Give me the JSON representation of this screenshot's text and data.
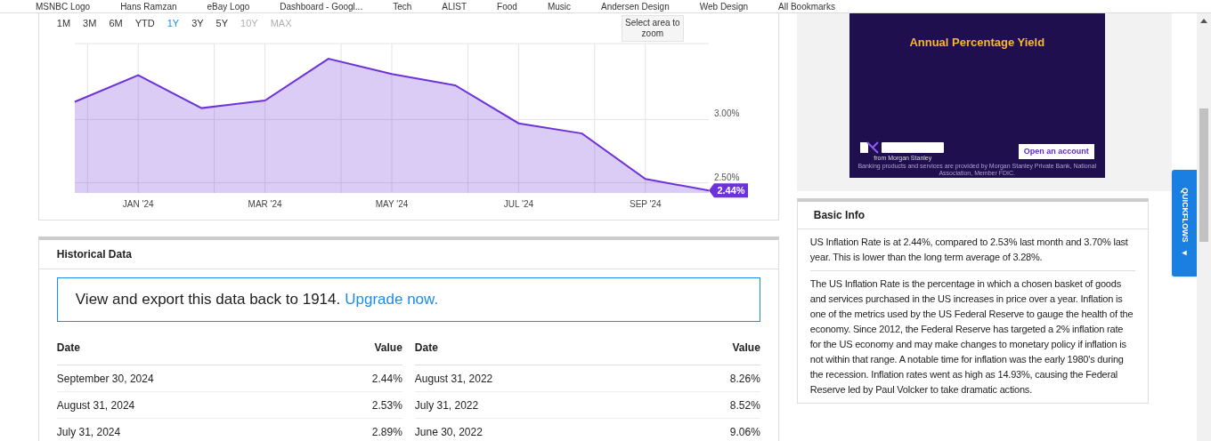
{
  "bookmarks": [
    "MSNBC Logo",
    "Hans Ramzan",
    "eBay Logo",
    "Dashboard - Googl...",
    "Tech",
    "ALIST",
    "Food",
    "Music",
    "Andersen Design",
    "Web Design",
    "All Bookmarks"
  ],
  "chart": {
    "ranges": [
      {
        "label": "1M",
        "selected": false,
        "disabled": false
      },
      {
        "label": "3M",
        "selected": false,
        "disabled": false
      },
      {
        "label": "6M",
        "selected": false,
        "disabled": false
      },
      {
        "label": "YTD",
        "selected": false,
        "disabled": false
      },
      {
        "label": "1Y",
        "selected": true,
        "disabled": false
      },
      {
        "label": "3Y",
        "selected": false,
        "disabled": false
      },
      {
        "label": "5Y",
        "selected": false,
        "disabled": false
      },
      {
        "label": "10Y",
        "selected": false,
        "disabled": true
      },
      {
        "label": "MAX",
        "selected": false,
        "disabled": true
      }
    ],
    "zoom_hint": "Select area to zoom",
    "last_value": "2.44%",
    "chart_data": {
      "type": "area",
      "grid": true,
      "categories": [
        null,
        "JAN '24",
        null,
        "MAR '24",
        null,
        "MAY '24",
        null,
        "JUL '24",
        null,
        "SEP '24",
        null
      ],
      "series": [
        {
          "color": "#6d32d9",
          "values": [
            3.14,
            3.35,
            3.09,
            3.15,
            3.48,
            3.36,
            3.27,
            2.97,
            2.89,
            2.53,
            2.44
          ]
        }
      ],
      "ylim": [
        2.42,
        3.6
      ],
      "yticks": [
        {
          "value": 2.5,
          "label": "2.50%"
        },
        {
          "value": 3.0,
          "label": "3.00%"
        }
      ]
    }
  },
  "historical": {
    "title": "Historical Data",
    "banner_text": "View and export this data back to 1914.",
    "banner_link": "Upgrade now.",
    "columns": [
      "Date",
      "Value",
      "Date",
      "Value"
    ],
    "rows": [
      [
        "September 30, 2024",
        "2.44%",
        "August 31, 2022",
        "8.26%"
      ],
      [
        "August 31, 2024",
        "2.53%",
        "July 31, 2022",
        "8.52%"
      ],
      [
        "July 31, 2024",
        "2.89%",
        "June 30, 2022",
        "9.06%"
      ]
    ]
  },
  "ad": {
    "headline": "Annual Percentage Yield",
    "brand_tagline": "from Morgan Stanley",
    "button": "Open an account",
    "disclaimer": "Banking products and services are provided by Morgan Stanley Private Bank, National Association, Member FDIC."
  },
  "quickflows": {
    "label": "QUICKFLOWS",
    "arrow": "◄"
  },
  "basic_info": {
    "title": "Basic Info",
    "paragraphs": [
      "US Inflation Rate is at 2.44%, compared to 2.53% last month and 3.70% last year. This is lower than the long term average of 3.28%.",
      "The US Inflation Rate is the percentage in which a chosen basket of goods and services purchased in the US increases in price over a year. Inflation is one of the metrics used by the US Federal Reserve to gauge the health of the economy. Since 2012, the Federal Reserve has targeted a 2% inflation rate for the US economy and may make changes to monetary policy if inflation is not within that range. A notable time for inflation was the early 1980's during the recession. Inflation rates went as high as 14.93%, causing the Federal Reserve led by Paul Volcker to take dramatic actions."
    ]
  }
}
